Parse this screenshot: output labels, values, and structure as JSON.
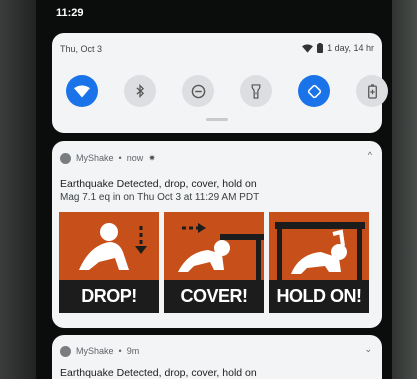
{
  "status_bar": {
    "time": "11:29"
  },
  "quick_settings": {
    "date": "Thu, Oct 3",
    "battery_text": "1 day, 14 hr",
    "tiles": [
      {
        "name": "wifi",
        "icon": "wifi-icon",
        "on": true
      },
      {
        "name": "bluetooth",
        "icon": "bluetooth-icon",
        "on": false
      },
      {
        "name": "do-not-disturb",
        "icon": "minus-circle-icon",
        "on": false
      },
      {
        "name": "flashlight",
        "icon": "flashlight-icon",
        "on": false
      },
      {
        "name": "auto-rotate",
        "icon": "rotate-icon",
        "on": true
      },
      {
        "name": "battery-saver",
        "icon": "battery-plus-icon",
        "on": false
      }
    ]
  },
  "notifications": [
    {
      "app": "MyShake",
      "time": "now",
      "title": "Earthquake Detected, drop, cover, hold on",
      "text": "Mag 7.1 eq in  on Thu Oct 3 at 11:29 AM PDT",
      "panels": [
        "DROP!",
        "COVER!",
        "HOLD ON!"
      ]
    },
    {
      "app": "MyShake",
      "time": "9m",
      "title": "Earthquake Detected, drop, cover, hold on"
    }
  ],
  "colors": {
    "accent": "#1a73e8",
    "panel_orange": "#d45a1f",
    "panel_black": "#1c1c1c"
  }
}
